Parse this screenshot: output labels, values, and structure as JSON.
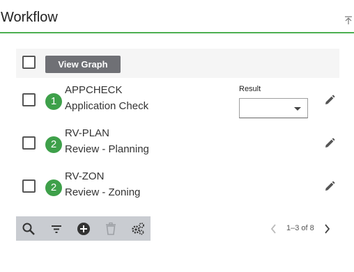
{
  "header": {
    "title": "Workflow"
  },
  "toolbar_top": {
    "view_graph_label": "View Graph"
  },
  "result": {
    "label": "Result",
    "selected": ""
  },
  "rows": [
    {
      "step": "1",
      "code": "APPCHECK",
      "description": "Application Check"
    },
    {
      "step": "2",
      "code": "RV-PLAN",
      "description": "Review - Planning"
    },
    {
      "step": "2",
      "code": "RV-ZON",
      "description": "Review - Zoning"
    }
  ],
  "bottom_toolbar": {
    "icons": [
      "search-icon",
      "filter-icon",
      "add-icon",
      "delete-icon",
      "settings-icon"
    ]
  },
  "pager": {
    "text": "1–3 of 8"
  },
  "colors": {
    "accent": "#4caf50",
    "badge": "#3ea04a",
    "button": "#6f7075",
    "toolbar": "#c9ccd1"
  }
}
